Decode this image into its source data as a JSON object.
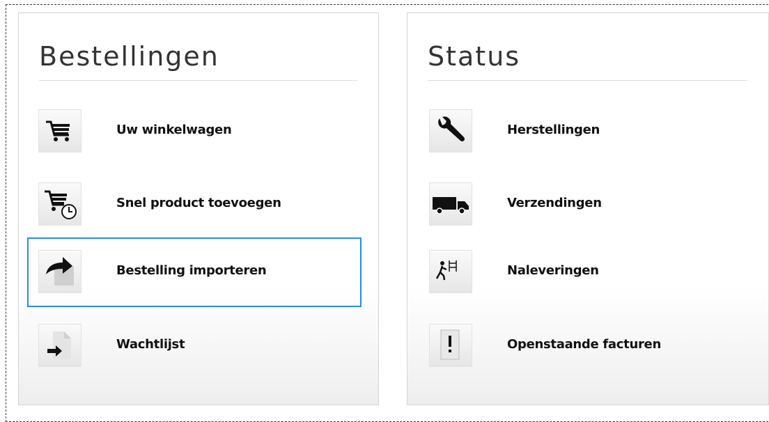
{
  "panels": {
    "orders": {
      "title": "Bestellingen",
      "items": [
        {
          "label": "Uw winkelwagen",
          "icon": "shopping-cart-icon"
        },
        {
          "label": "Snel product toevoegen",
          "icon": "cart-clock-icon"
        },
        {
          "label": "Bestelling importeren",
          "icon": "import-arrow-icon",
          "selected": true
        },
        {
          "label": "Wachtlijst",
          "icon": "document-arrow-icon"
        }
      ]
    },
    "status": {
      "title": "Status",
      "items": [
        {
          "label": "Herstellingen",
          "icon": "wrench-icon"
        },
        {
          "label": "Verzendingen",
          "icon": "truck-icon"
        },
        {
          "label": "Naleveringen",
          "icon": "worker-pallet-icon"
        },
        {
          "label": "Openstaande facturen",
          "icon": "exclamation-document-icon"
        }
      ]
    }
  },
  "colors": {
    "selection_border": "#2a8ae8",
    "panel_border": "#d4d4d4",
    "title_text": "#333333",
    "label_text": "#111111"
  }
}
